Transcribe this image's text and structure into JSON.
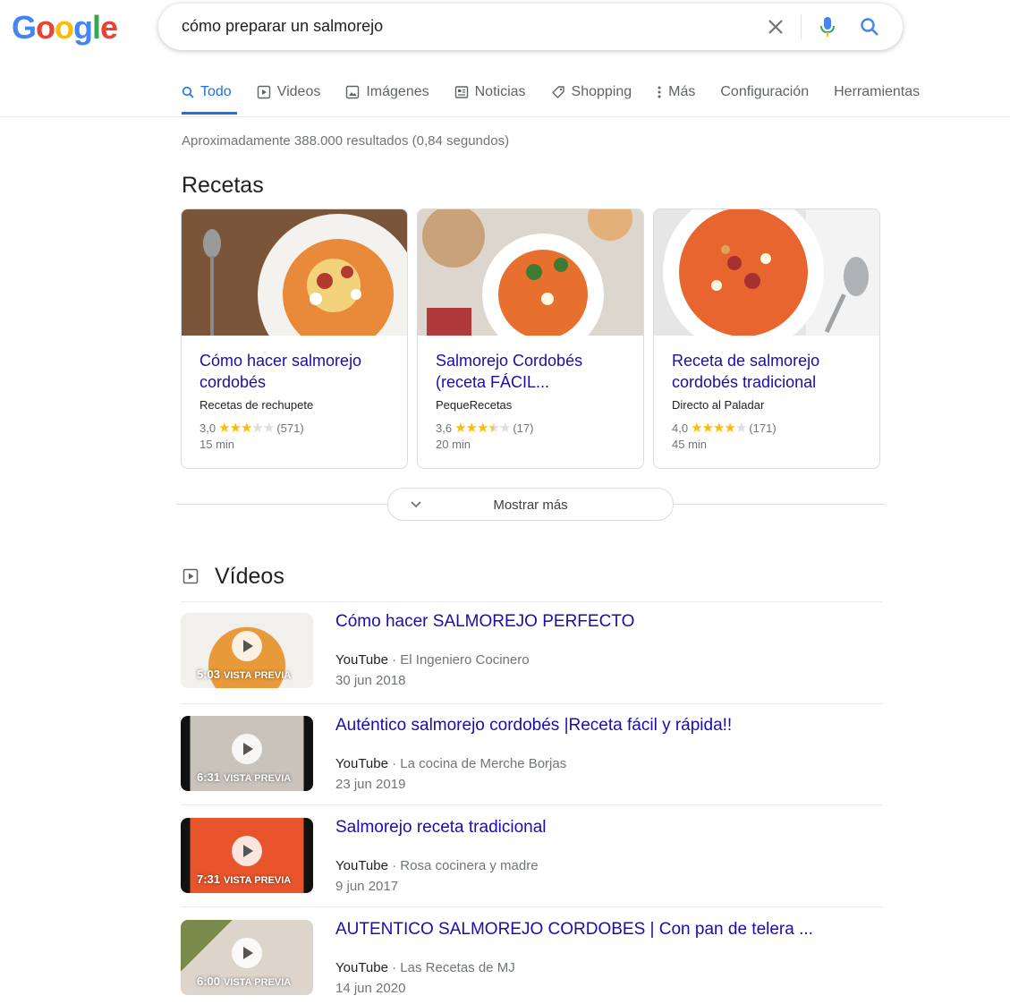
{
  "search": {
    "query": "cómo preparar un salmorejo"
  },
  "logo": {
    "letters": [
      "G",
      "o",
      "o",
      "g",
      "l",
      "e"
    ],
    "colors": [
      "#4285f4",
      "#ea4335",
      "#fbbc05",
      "#4285f4",
      "#34a853",
      "#ea4335"
    ]
  },
  "tabs": [
    {
      "label": "Todo",
      "icon": "search-icon",
      "active": true
    },
    {
      "label": "Videos",
      "icon": "video-icon"
    },
    {
      "label": "Imágenes",
      "icon": "image-icon"
    },
    {
      "label": "Noticias",
      "icon": "news-icon"
    },
    {
      "label": "Shopping",
      "icon": "tag-icon"
    },
    {
      "label": "Más",
      "icon": "more-vert-icon"
    },
    {
      "label": "Configuración"
    },
    {
      "label": "Herramientas"
    }
  ],
  "result_stats": "Aproximadamente 388.000 resultados (0,84 segundos)",
  "recipes": {
    "title": "Recetas",
    "items": [
      {
        "title": "Cómo hacer salmorejo cordobés",
        "source": "Recetas de rechupete",
        "rating": "3,0",
        "stars": 3,
        "reviews": "(571)",
        "time": "15 min"
      },
      {
        "title": "Salmorejo Cordobés (receta FÁCIL...",
        "source": "PequeRecetas",
        "rating": "3,6",
        "stars": 3.5,
        "reviews": "(17)",
        "time": "20 min"
      },
      {
        "title": "Receta de salmorejo cordobés tradicional",
        "source": "Directo al Paladar",
        "rating": "4,0",
        "stars": 4,
        "reviews": "(171)",
        "time": "45 min"
      }
    ],
    "more_label": "Mostrar más"
  },
  "videos": {
    "title": "Vídeos",
    "preview_label": "VISTA PREVIA",
    "items": [
      {
        "title": "Cómo hacer SALMOREJO PERFECTO",
        "site": "YouTube",
        "channel": "El Ingeniero Cocinero",
        "date": "30 jun 2018",
        "duration": "5:03"
      },
      {
        "title": "Auténtico salmorejo cordobés |Receta fácil y rápida!!",
        "site": "YouTube",
        "channel": "La cocina de Merche Borjas",
        "date": "23 jun 2019",
        "duration": "6:31"
      },
      {
        "title": "Salmorejo receta tradicional",
        "site": "YouTube",
        "channel": "Rosa cocinera y madre",
        "date": "9 jun 2017",
        "duration": "7:31"
      },
      {
        "title": "AUTENTICO SALMOREJO CORDOBES | Con pan de telera ...",
        "site": "YouTube",
        "channel": "Las Recetas de MJ",
        "date": "14 jun 2020",
        "duration": "6:00"
      }
    ],
    "separator": " · "
  },
  "colors": {
    "link": "#1a0dab",
    "accent": "#1a73e8",
    "star": "#fbbc04"
  }
}
